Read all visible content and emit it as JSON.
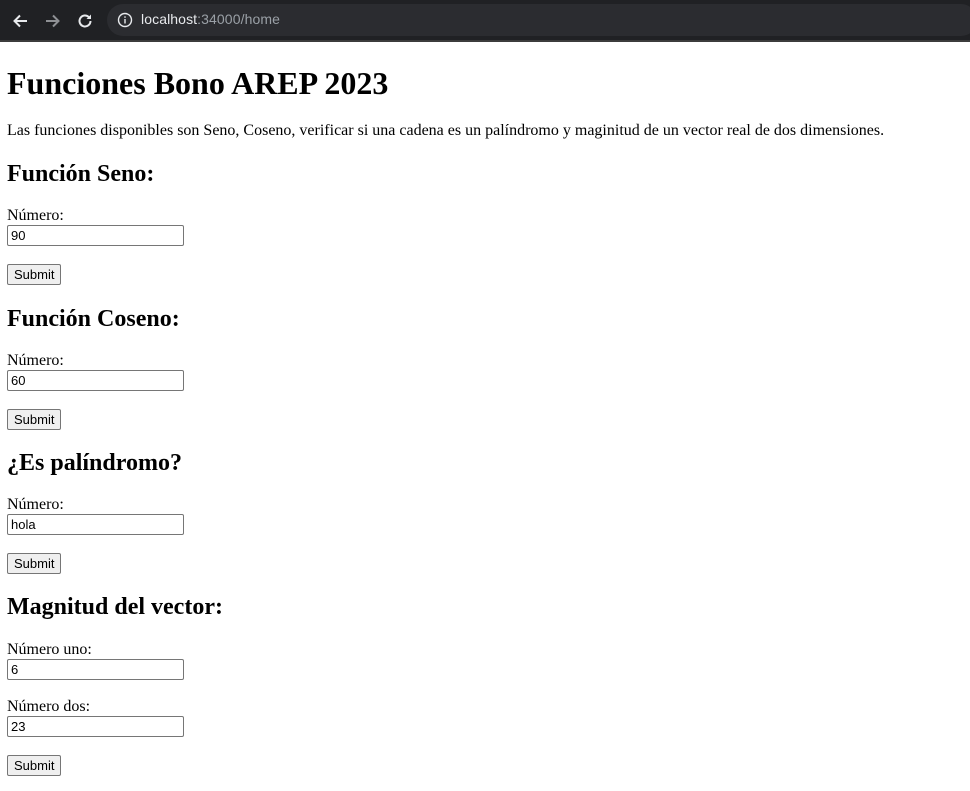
{
  "browser": {
    "url_host": "localhost",
    "url_rest": ":34000/home"
  },
  "page": {
    "title": "Funciones Bono AREP 2023",
    "description": "Las funciones disponibles son Seno, Coseno, verificar si una cadena es un palíndromo y maginitud de un vector real de dos dimensiones."
  },
  "sections": {
    "seno": {
      "heading": "Función Seno:",
      "label": "Número:",
      "value": "90",
      "submit": "Submit"
    },
    "coseno": {
      "heading": "Función Coseno:",
      "label": "Número:",
      "value": "60",
      "submit": "Submit"
    },
    "palindromo": {
      "heading": "¿Es palíndromo?",
      "label": "Número:",
      "value": "hola",
      "submit": "Submit"
    },
    "vector": {
      "heading": "Magnitud del vector:",
      "label1": "Número uno:",
      "value1": "6",
      "label2": "Número dos:",
      "value2": "23",
      "submit": "Submit"
    }
  }
}
